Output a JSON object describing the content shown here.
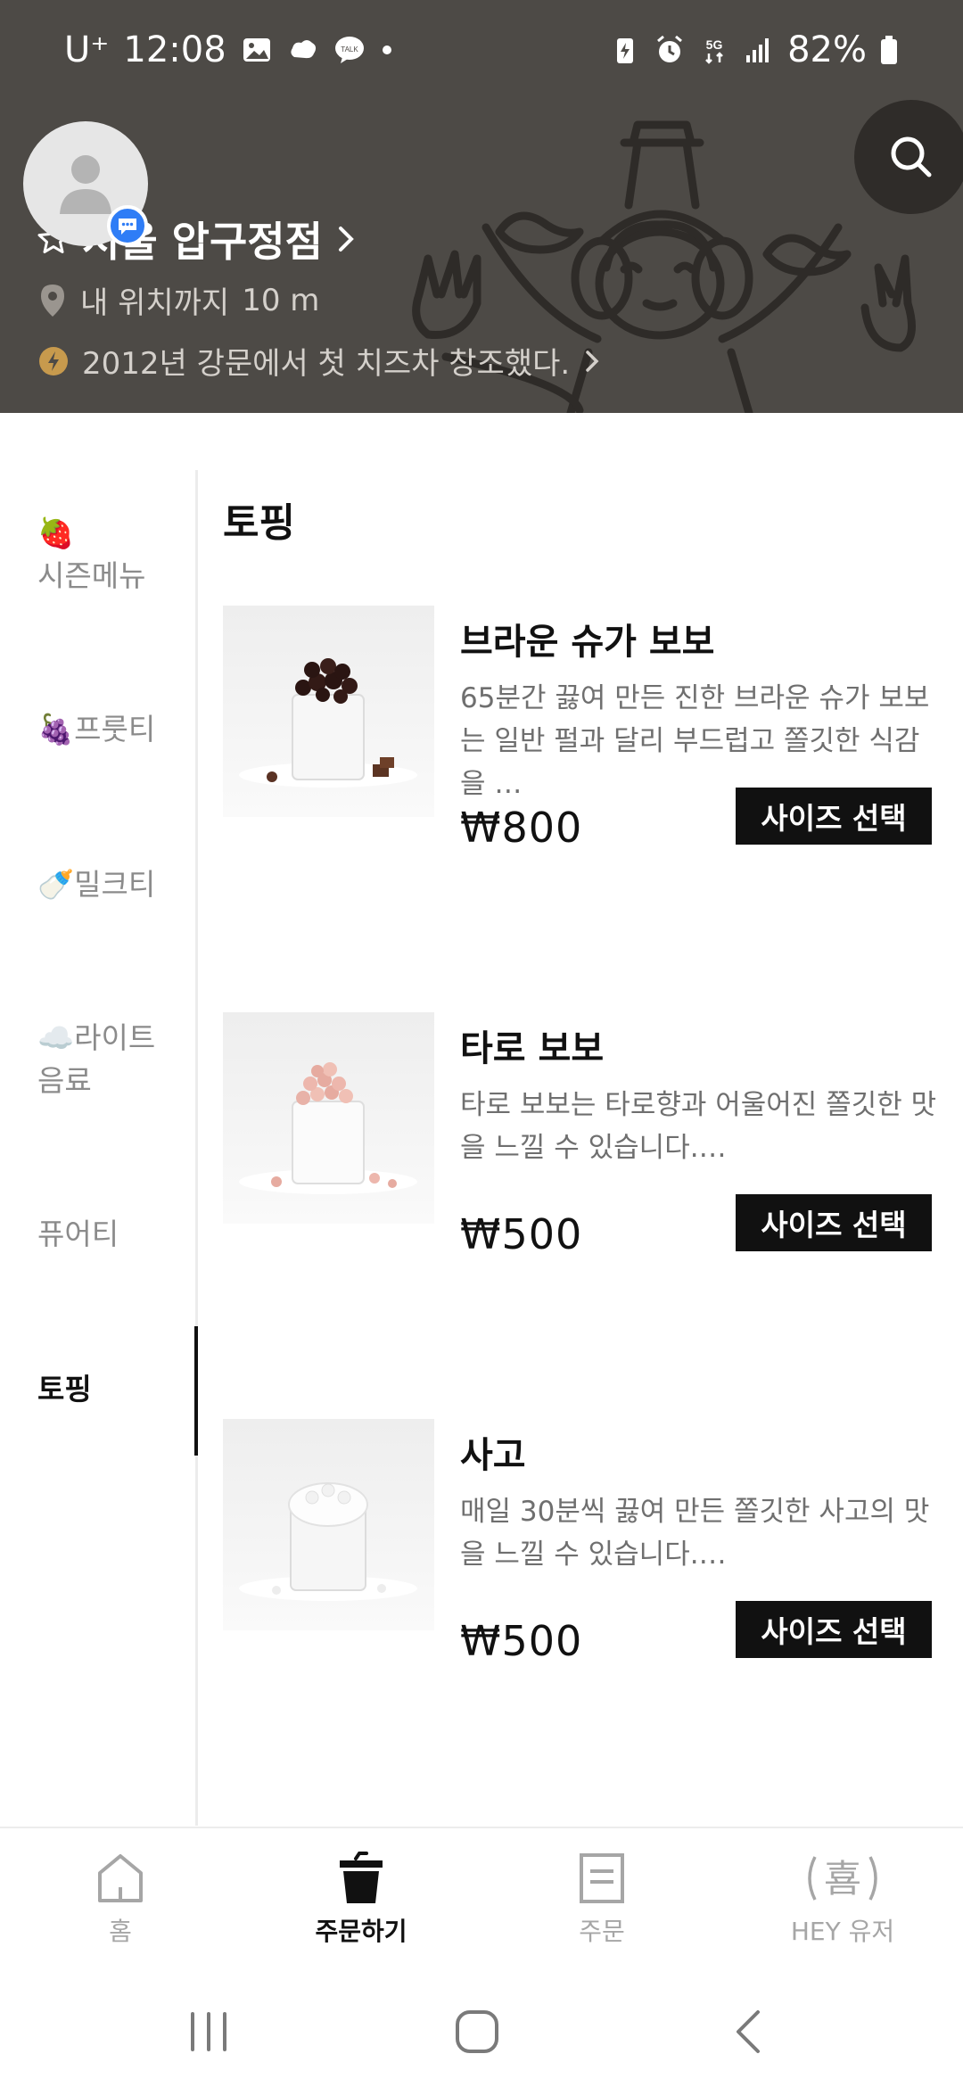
{
  "status_bar": {
    "carrier": "U⁺",
    "time": "12:08",
    "battery": "82%",
    "network": "5G"
  },
  "header": {
    "store_name": "서울 압구정점",
    "distance_label": "내 위치까지",
    "distance_value": "10 m",
    "tagline": "2012년 강문에서 첫 치즈차 창조했다."
  },
  "sidebar": {
    "items": [
      {
        "emoji": "🍓",
        "label": "시즌메뉴"
      },
      {
        "emoji": "🍇",
        "label": "프룻티"
      },
      {
        "emoji": "🍼",
        "label": "밀크티"
      },
      {
        "emoji": "☁️",
        "label": "라이트 음료"
      },
      {
        "emoji": "",
        "label": "퓨어티"
      },
      {
        "emoji": "",
        "label": "토핑"
      }
    ],
    "active_index": 5
  },
  "section": {
    "title": "토핑"
  },
  "products": [
    {
      "name": "브라운 슈가 보보",
      "description": "65분간 끓여 만든 진한 브라운 슈가 보보는 일반 펄과 달리 부드럽고 쫄깃한 식감을 …",
      "price": "₩800",
      "button": "사이즈 선택"
    },
    {
      "name": "타로 보보",
      "description": "타로 보보는 타로향과 어울어진 쫄깃한 맛을 느낄 수 있습니다.…",
      "price": "₩500",
      "button": "사이즈 선택"
    },
    {
      "name": "사고",
      "description": "매일 30분씩 끓여 만든 쫄깃한 사고의 맛을 느낄 수 있습니다.…",
      "price": "₩500",
      "button": "사이즈 선택"
    }
  ],
  "bottom_nav": {
    "items": [
      {
        "label": "홈",
        "icon": "home-icon"
      },
      {
        "label": "주문하기",
        "icon": "cup-icon"
      },
      {
        "label": "주문",
        "icon": "receipt-icon"
      },
      {
        "label": "HEY 유저",
        "icon": "hey-icon",
        "glyph": "喜"
      }
    ],
    "active_index": 1
  },
  "colors": {
    "header_bg": "#4d4a46",
    "accent_black": "#111111",
    "badge_blue": "#2f7df6"
  }
}
